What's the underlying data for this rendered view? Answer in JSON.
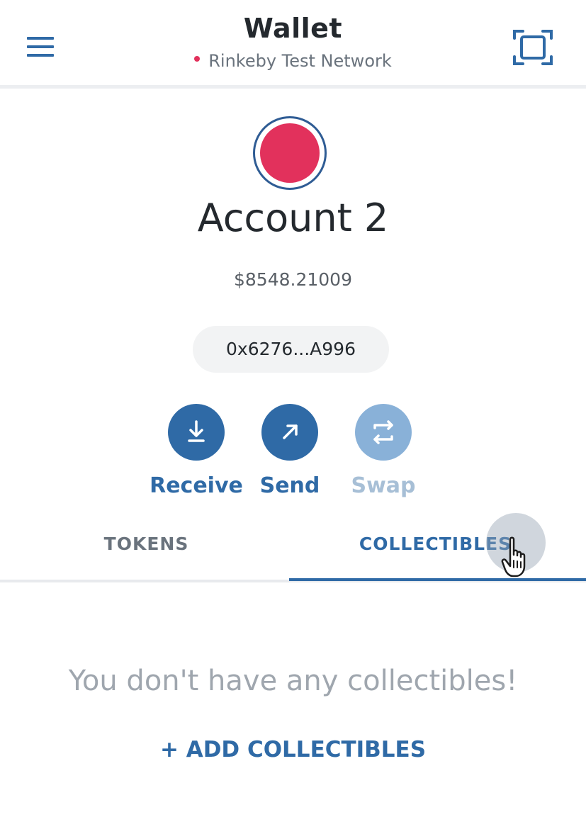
{
  "header": {
    "title": "Wallet",
    "network": "Rinkeby Test Network",
    "network_color": "#e2315c",
    "menu_icon": "hamburger-icon",
    "scan_icon": "qr-scan-icon"
  },
  "account": {
    "name": "Account 2",
    "balance": "$8548.21009",
    "address": "0x6276...A996",
    "avatar_color": "#e2315c"
  },
  "actions": [
    {
      "label": "Receive",
      "icon": "download-icon",
      "enabled": true
    },
    {
      "label": "Send",
      "icon": "arrow-up-right-icon",
      "enabled": true
    },
    {
      "label": "Swap",
      "icon": "swap-icon",
      "enabled": false
    }
  ],
  "tabs": [
    {
      "label": "TOKENS",
      "active": false
    },
    {
      "label": "COLLECTIBLES",
      "active": true
    }
  ],
  "empty_state": {
    "message": "You don't have any collectibles!",
    "add_link": "+ ADD COLLECTIBLES"
  },
  "colors": {
    "accent": "#2f6aa6",
    "accent_disabled": "#89b1d8",
    "muted_text": "#9fa6ae"
  }
}
